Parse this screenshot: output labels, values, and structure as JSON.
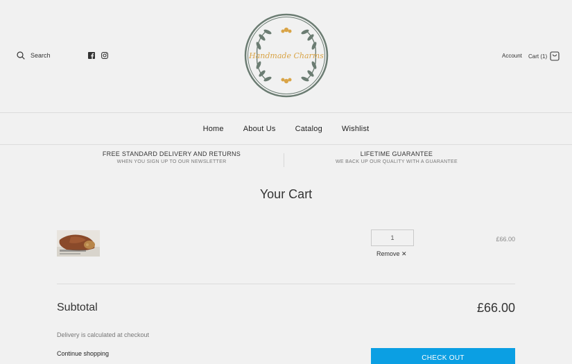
{
  "header": {
    "search_label": "Search",
    "social_icons": [
      "facebook-icon",
      "instagram-icon"
    ],
    "logo_text": "Handmade Charms",
    "account_label": "Account",
    "cart_label": "Cart (1)",
    "logo_ring_color": "#6b7c72",
    "logo_text_color": "#d9a447"
  },
  "nav": {
    "items": [
      {
        "label": "Home"
      },
      {
        "label": "About Us"
      },
      {
        "label": "Catalog"
      },
      {
        "label": "Wishlist"
      }
    ]
  },
  "promos": [
    {
      "title": "FREE STANDARD DELIVERY AND RETURNS",
      "subtitle": "WHEN YOU SIGN UP TO OUR NEWSLETTER"
    },
    {
      "title": "LIFETIME GUARANTEE",
      "subtitle": "WE BACK UP OUR QUALITY WITH A GUARANTEE"
    }
  ],
  "cart": {
    "title": "Your Cart",
    "items": [
      {
        "quantity": "1",
        "remove_label": "Remove ✕",
        "price": "£66.00"
      }
    ],
    "subtotal_label": "Subtotal",
    "subtotal_value": "£66.00",
    "delivery_note": "Delivery is calculated at checkout",
    "continue_label": "Continue shopping",
    "checkout_label": "CHECK OUT",
    "checkout_color": "#0b9fe3"
  }
}
